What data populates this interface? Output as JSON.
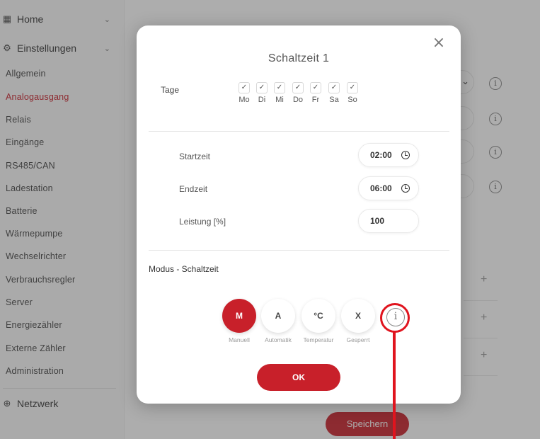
{
  "sidebar": {
    "home": {
      "label": "Home"
    },
    "settings": {
      "label": "Einstellungen"
    },
    "items": [
      {
        "label": "Allgemein"
      },
      {
        "label": "Analogausgang"
      },
      {
        "label": "Relais"
      },
      {
        "label": "Eingänge"
      },
      {
        "label": "RS485/CAN"
      },
      {
        "label": "Ladestation"
      },
      {
        "label": "Batterie"
      },
      {
        "label": "Wärmepumpe"
      },
      {
        "label": "Wechselrichter"
      },
      {
        "label": "Verbrauchsregler"
      },
      {
        "label": "Server"
      },
      {
        "label": "Energiezähler"
      },
      {
        "label": "Externe Zähler"
      },
      {
        "label": "Administration"
      }
    ],
    "network": {
      "label": "Netzwerk"
    }
  },
  "background": {
    "save_label": "Speichern"
  },
  "modal": {
    "title": "Schaltzeit 1",
    "days_label": "Tage",
    "days": [
      {
        "label": "Mo",
        "checked": true
      },
      {
        "label": "Di",
        "checked": true
      },
      {
        "label": "Mi",
        "checked": true
      },
      {
        "label": "Do",
        "checked": true
      },
      {
        "label": "Fr",
        "checked": true
      },
      {
        "label": "Sa",
        "checked": true
      },
      {
        "label": "So",
        "checked": true
      }
    ],
    "check_mark": "✓",
    "start": {
      "label": "Startzeit",
      "value": "02:00"
    },
    "end": {
      "label": "Endzeit",
      "value": "06:00"
    },
    "power": {
      "label": "Leistung [%]",
      "value": "100"
    },
    "mode_label": "Modus - Schaltzeit",
    "modes": [
      {
        "symbol": "M",
        "caption": "Manuell",
        "active": true
      },
      {
        "symbol": "A",
        "caption": "Automatik",
        "active": false
      },
      {
        "symbol": "°C",
        "caption": "Temperatur",
        "active": false
      },
      {
        "symbol": "X",
        "caption": "Gesperrt",
        "active": false
      }
    ],
    "ok_label": "OK"
  },
  "colors": {
    "accent": "#c8202a",
    "annotation": "#e0141e"
  }
}
